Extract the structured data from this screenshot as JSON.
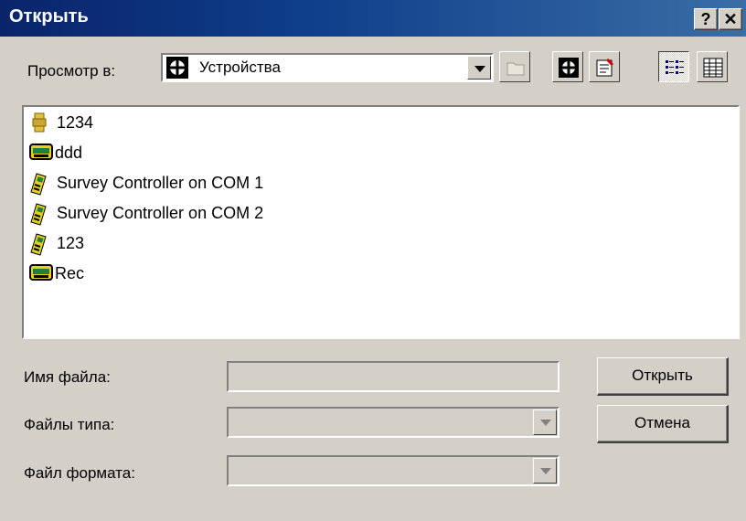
{
  "window": {
    "title": "Открыть",
    "help_label": "?",
    "close_label": "✕"
  },
  "lookin": {
    "label": "Просмотр в:",
    "value": "Устройства",
    "icon": "devices-icon"
  },
  "toolbar": {
    "buttons": [
      "up-folder-icon",
      "devices-icon",
      "properties-icon",
      "list-view-icon",
      "details-view-icon"
    ],
    "active": "list-view-icon"
  },
  "files": [
    {
      "name": "1234",
      "icon": "gps-receiver-icon"
    },
    {
      "name": "ddd",
      "icon": "data-recorder-icon"
    },
    {
      "name": "Survey Controller on COM 1",
      "icon": "survey-controller-icon"
    },
    {
      "name": "Survey Controller on COM 2",
      "icon": "survey-controller-icon"
    },
    {
      "name": "123",
      "icon": "survey-controller-icon"
    },
    {
      "name": "Rec",
      "icon": "data-recorder-icon"
    }
  ],
  "form": {
    "filename_label": "Имя файла:",
    "filename_value": "",
    "filetype_label": "Файлы типа:",
    "filetype_value": "",
    "format_label": "Файл формата:",
    "format_value": ""
  },
  "buttons": {
    "open": "Открыть",
    "cancel": "Отмена"
  },
  "colors": {
    "titlebar": "#0a246a",
    "face": "#d4d0c8"
  }
}
